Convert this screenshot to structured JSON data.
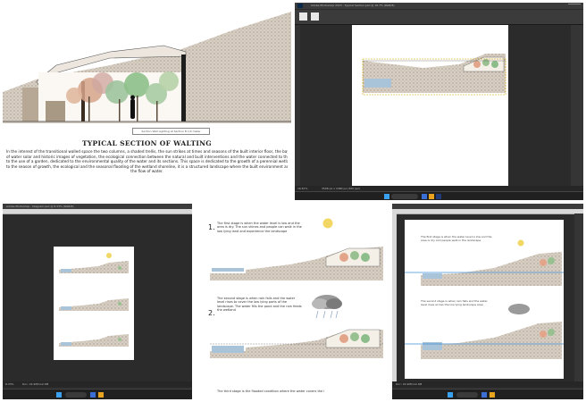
{
  "panel1": {
    "caption": "TYPICAL SECTION OF WALTING",
    "label_box": "Section Wall Lighting at Section B 1/4 meter",
    "body_lines": [
      "In the interest of the transitional walled space the two columns, a shaded trellis, the sun strikes at times and seasons of the built interior floor, the bay is regressive type",
      "of water solar and historic images of vegetation, the ecological connection between the natural and built interventions and the water connected to the bay is in relation",
      "to the use of a garden, dedicated to the environmental quality of the water and its sections. This space is dedicated to the growth of a perennial wetland plant growth in relation",
      "to the season of growth, the ecological and the seasonal flooding of the wetland shoreline, it is a structured landscape where the built environment and its context",
      "the flow of water."
    ]
  },
  "panel2": {
    "title": "Adobe Photoshop 2023 - Typical Section.psd @ 16.7% (RGB/8)",
    "zoom": "16.67%",
    "status": "3508 px x 2480 px (300 ppi)",
    "search_placeholder": "Search"
  },
  "panel3": {
    "title": "Adobe Photoshop - Diagram.psd @ 8.33% (RGB/8)",
    "zoom": "8.33%",
    "status": "Doc: 24.9M/112.4M",
    "search_placeholder": "Search"
  },
  "panel4": {
    "step1_number": "1.",
    "step1_text": "The first stage is when the water level is low and the area is dry. The sun shines and people can walk in the low lying land and experience the landscape",
    "step2_number": "2.",
    "step2_text": "The second stage is when rain falls and the water level rises to cover the low lying parts of the landscape. The water fills the pond and the rain feeds the wetland",
    "step3_text": "The third stage is the flooded condition where the water covers the landscape"
  },
  "panel5": {
    "status": "Doc: 24.9M/112.4M",
    "search_placeholder": "Search",
    "step_text_1": "The first stage is when the water level is low and the area is dry and people walk in the landscape",
    "step_text_2": "The second stage is when rain falls and the water level rises across the low lying landscape area"
  },
  "colors": {
    "ps_dark": "#2b2b2b",
    "ps_bar": "#3b3b3b",
    "taskbar": "#202020",
    "sun": "#f2d764",
    "water": "#a9c4d8",
    "selection": "#3e8fd6"
  }
}
